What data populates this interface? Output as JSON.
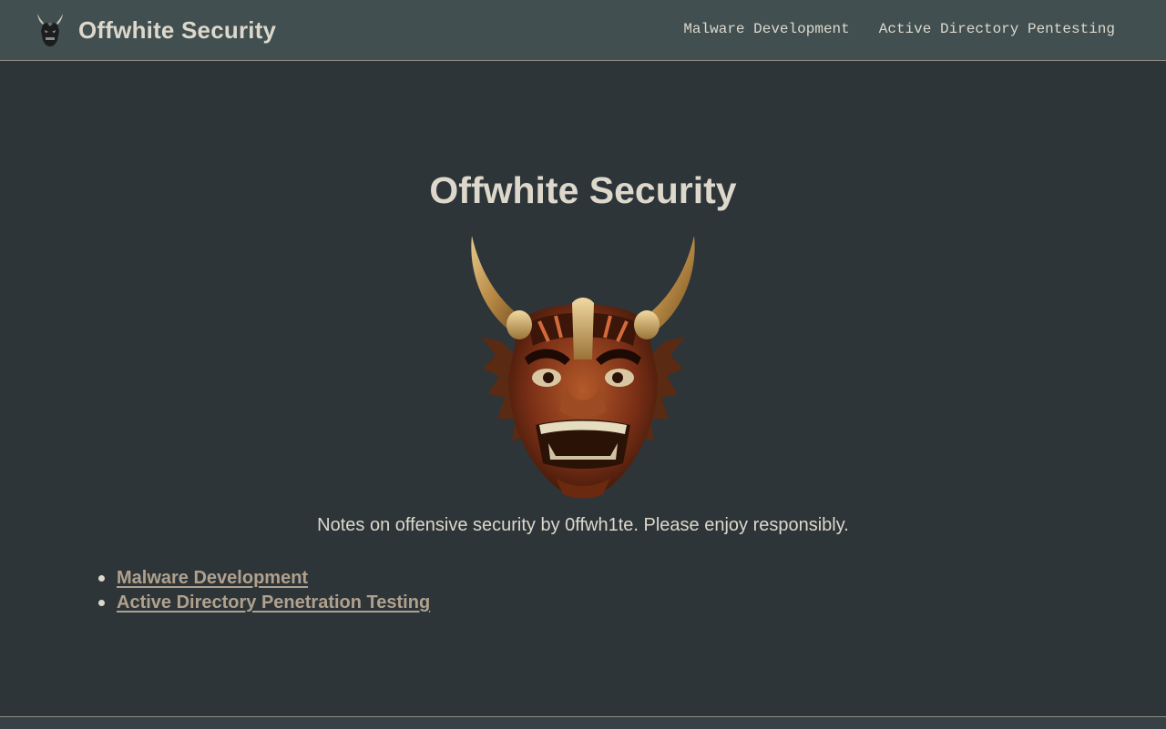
{
  "header": {
    "site_title": "Offwhite Security",
    "logo_icon": "oni-mask-icon",
    "nav": [
      {
        "label": "Malware Development"
      },
      {
        "label": "Active Directory Pentesting"
      }
    ]
  },
  "main": {
    "title": "Offwhite Security",
    "hero_image": "oni-mask-icon",
    "tagline": "Notes on offensive security by 0ffwh1te. Please enjoy responsibly.",
    "links": [
      {
        "label": "Malware Development"
      },
      {
        "label": "Active Directory Penetration Testing"
      }
    ]
  },
  "colors": {
    "header_bg": "#414f51",
    "page_bg": "#2d3539",
    "text": "#ddd8cb",
    "link": "#b0a18d"
  }
}
